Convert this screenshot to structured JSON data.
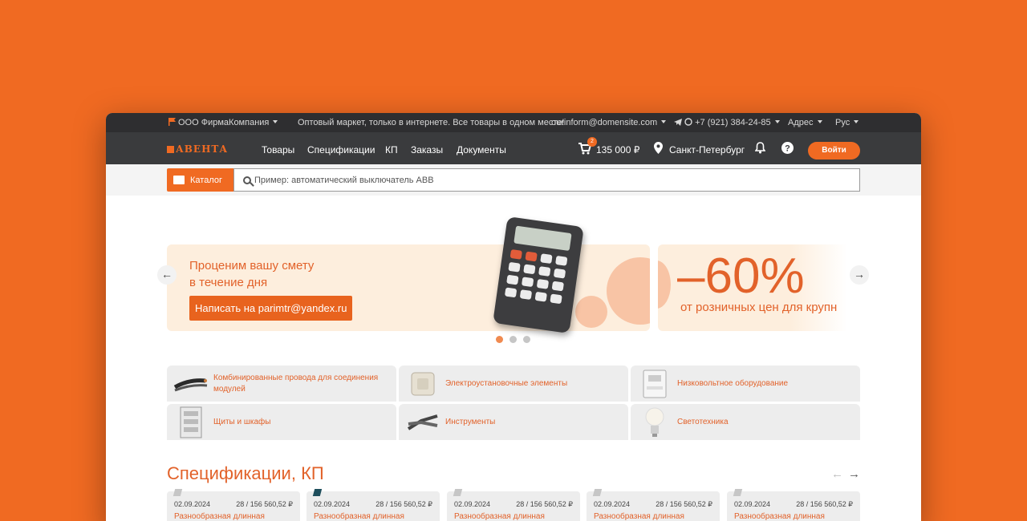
{
  "topbar": {
    "company": "ООО ФирмаКомпания",
    "slogan": "Оптовый маркет, только в интернете. Все товары в одном месте!",
    "email": "ourinform@domensite.com",
    "phone": "+7 (921) 384-24-85",
    "address": "Адрес",
    "lang": "Рус"
  },
  "navbar": {
    "logo": "АВЕНТА",
    "links": [
      "Товары",
      "Спецификации",
      "КП",
      "Заказы",
      "Документы"
    ],
    "cart_count": "2",
    "cart_total": "135 000 ₽",
    "city": "Санкт-Петербург",
    "login": "Войти"
  },
  "search": {
    "catalog": "Каталог",
    "placeholder": "Пример: автоматический выключатель ABB"
  },
  "banners": {
    "b1_title": "Проценим вашу смету\nв течение дня",
    "b1_button": "Написать на parimtr@yandex.ru",
    "b2_big": "–60%",
    "b2_sub": "от розничных цен для крупн"
  },
  "categories": [
    {
      "label": "Комбинированные провода для соединения модулей",
      "icon": "cable-icon"
    },
    {
      "label": "Электроустановочные элементы",
      "icon": "socket-icon"
    },
    {
      "label": "Низковольтное оборудование",
      "icon": "meter-icon"
    },
    {
      "label": "Щиты и шкафы",
      "icon": "cabinet-icon"
    },
    {
      "label": "Инструменты",
      "icon": "pliers-icon"
    },
    {
      "label": "Светотехника",
      "icon": "bulb-icon"
    }
  ],
  "specs": {
    "title": "Спецификации, КП",
    "cards": [
      {
        "date": "02.09.2024",
        "sum": "28 / 156 560,52 ₽",
        "name": "Разнообразная длинная"
      },
      {
        "date": "02.09.2024",
        "sum": "28 / 156 560,52 ₽",
        "name": "Разнообразная длинная"
      },
      {
        "date": "02.09.2024",
        "sum": "28 / 156 560,52 ₽",
        "name": "Разнообразная длинная"
      },
      {
        "date": "02.09.2024",
        "sum": "28 / 156 560,52 ₽",
        "name": "Разнообразная длинная"
      },
      {
        "date": "02.09.2024",
        "sum": "28 / 156 560,52 ₽",
        "name": "Разнообразная длинная"
      }
    ]
  },
  "colors": {
    "accent": "#f06a22",
    "dark": "#3a3b3d"
  }
}
